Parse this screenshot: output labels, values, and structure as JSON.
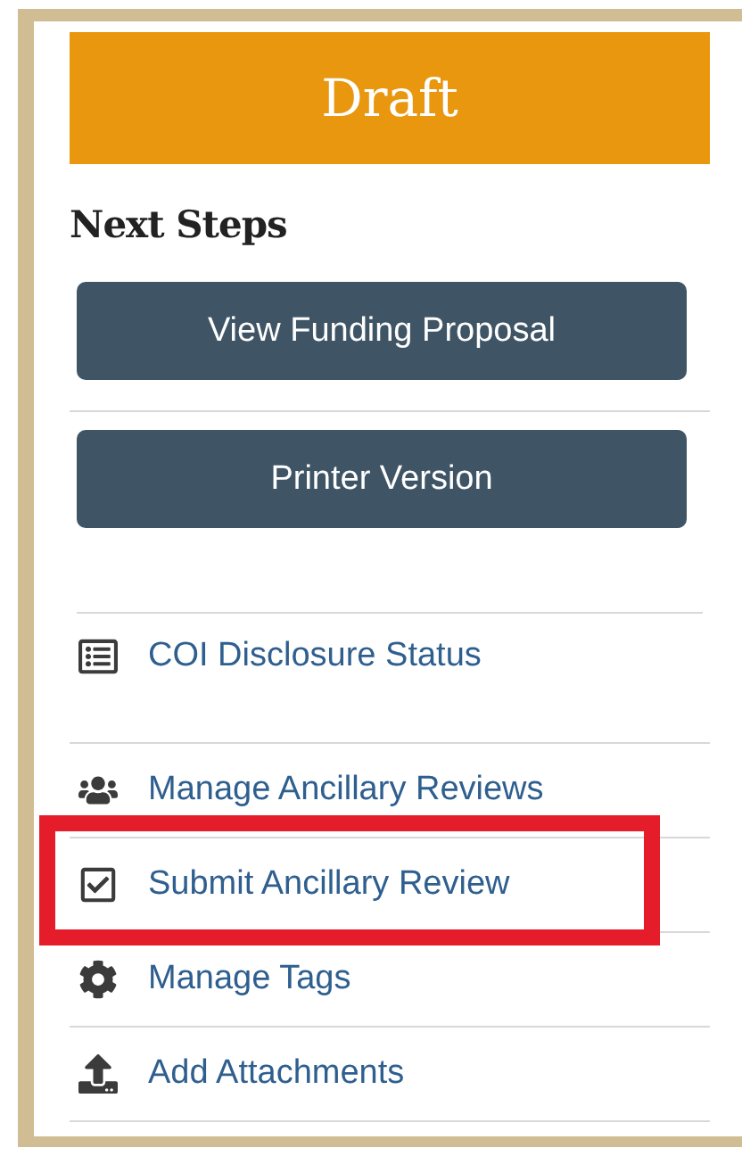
{
  "status_banner": {
    "text": "Draft"
  },
  "next_steps": {
    "heading": "Next Steps",
    "buttons": [
      "View Funding Proposal",
      "Printer Version"
    ],
    "links": [
      {
        "label": "COI Disclosure Status",
        "kind": "list",
        "highlighted": false
      },
      {
        "label": "Manage Ancillary Reviews",
        "kind": "users",
        "highlighted": false
      },
      {
        "label": "Submit Ancillary Review",
        "kind": "check",
        "highlighted": true
      },
      {
        "label": "Manage Tags",
        "kind": "gear",
        "highlighted": false
      },
      {
        "label": "Add Attachments",
        "kind": "upload",
        "highlighted": false
      }
    ]
  }
}
